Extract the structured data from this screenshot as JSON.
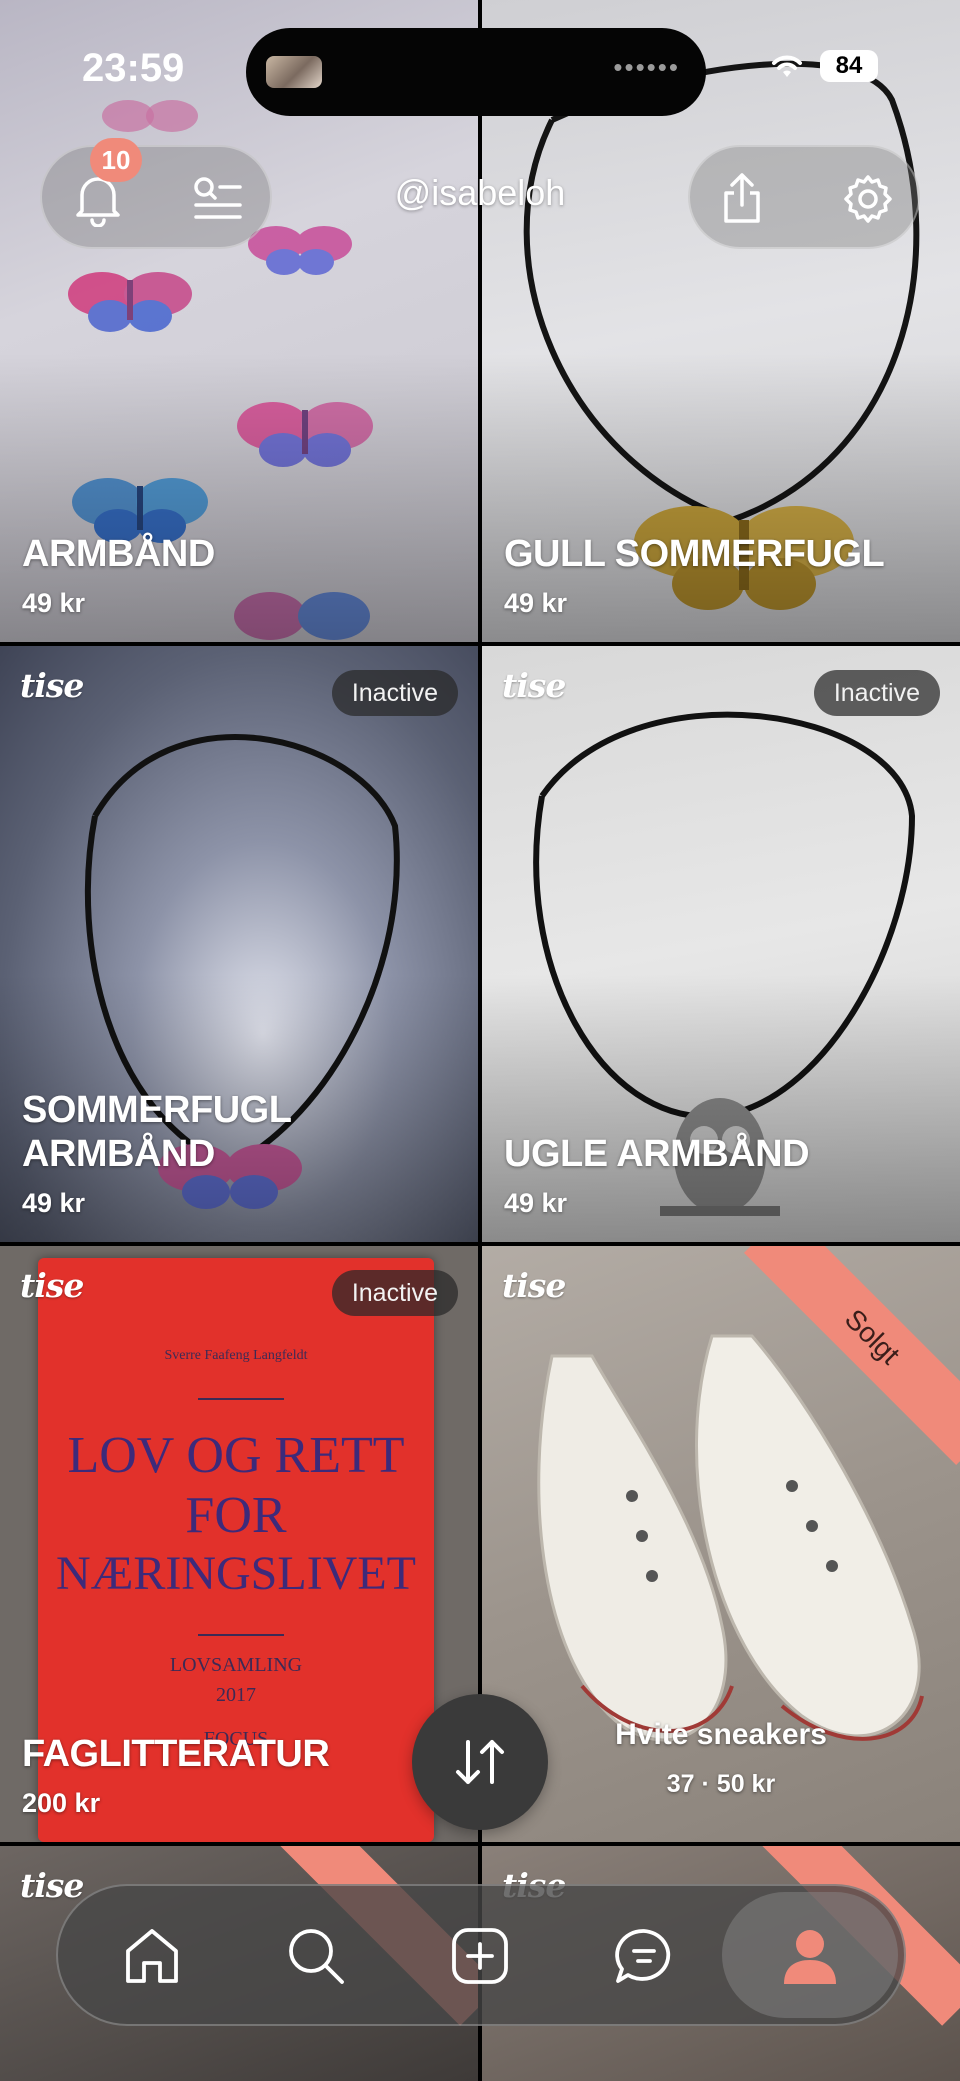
{
  "status_bar": {
    "time": "23:59",
    "battery": "84"
  },
  "header": {
    "username": "@isabeloh",
    "notification_count": "10"
  },
  "listings": [
    {
      "title": "ARMBÅND",
      "price": "49 kr",
      "status": ""
    },
    {
      "title": "GULL SOMMERFUGL",
      "price": "49 kr",
      "status": ""
    },
    {
      "title_line1": "SOMMERFUGL",
      "title_line2": "ARMBÅND",
      "price": "49 kr",
      "status": "Inactive"
    },
    {
      "title": "UGLE ARMBÅND",
      "price": "49 kr",
      "status": "Inactive"
    },
    {
      "title": "FAGLITTERATUR",
      "price": "200 kr",
      "status": "Inactive"
    },
    {
      "title": "Hvite sneakers",
      "price": "37 · 50 kr",
      "status": "Solgt"
    }
  ],
  "watermark": "tise",
  "book_cover": {
    "author": "Sverre Faafeng Langfeldt",
    "title_line1": "LOV OG RETT",
    "title_line2": "FOR",
    "title_line3": "NÆRINGSLIVET",
    "subtitle": "LOVSAMLING",
    "year": "2017",
    "publisher": "FOCUS"
  },
  "tab_bar": {
    "items": [
      "home",
      "search",
      "add",
      "messages",
      "profile"
    ],
    "active": "profile",
    "accent": "#f08a7a"
  }
}
